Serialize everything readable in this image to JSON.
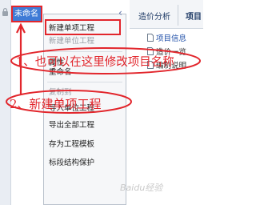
{
  "project_node": {
    "label": "未命名"
  },
  "tabs": [
    {
      "label": "造价分析"
    },
    {
      "label": "项目"
    }
  ],
  "tree": {
    "items": [
      {
        "label": "项目信息",
        "color": "#1f4fa8"
      },
      {
        "label": "造价一览"
      },
      {
        "label": "编制说明"
      }
    ]
  },
  "context_menu": {
    "items": [
      {
        "label": "新建单项工程",
        "disabled": false
      },
      {
        "label": "新建单位工程",
        "disabled": true
      },
      {
        "label": "属性",
        "disabled": false
      },
      {
        "label": "重命名",
        "disabled": false
      },
      {
        "label": "复制到",
        "disabled": true
      },
      {
        "label": "导入单位工程",
        "disabled": false
      },
      {
        "label": "导出全部工程",
        "disabled": false
      },
      {
        "label": "存为工程模板",
        "disabled": false
      },
      {
        "label": "标段结构保护",
        "disabled": false
      }
    ]
  },
  "annotations": {
    "step1": "1、也可以在这里修改项目名称",
    "step2": "2、新建单项工程"
  },
  "watermark": "Baidu经验",
  "colors": {
    "annotation": "#e2262c",
    "selection": "#3f7bd6"
  }
}
